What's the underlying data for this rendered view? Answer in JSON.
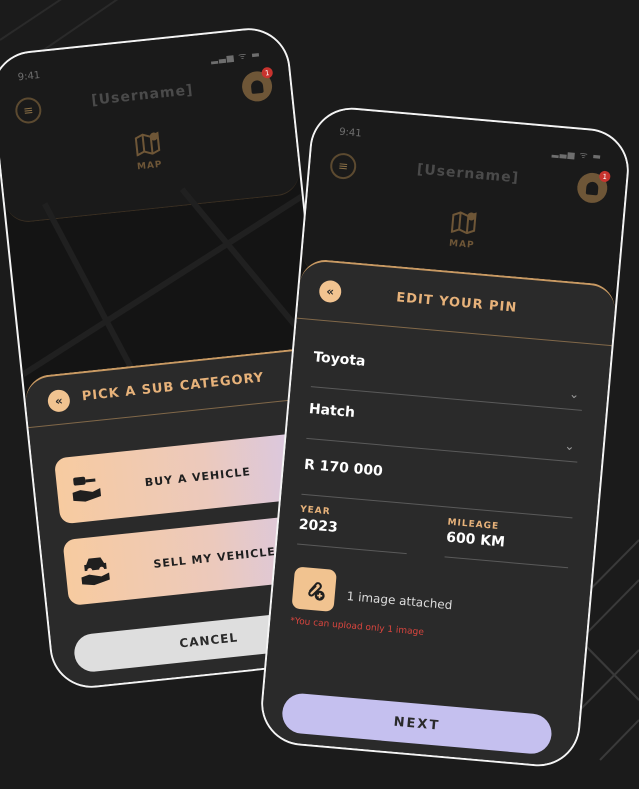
{
  "phone_a": {
    "status_time": "9:41",
    "status_icons": "▂▃▅ ᯤ ▬",
    "menu_icon": "menu-icon",
    "username": "[Username]",
    "notification_badge": "1",
    "map_label": "MAP",
    "sheet": {
      "title": "PICK A SUB CATEGORY",
      "back_glyph": "«",
      "options": [
        {
          "label": "BUY A VEHICLE",
          "icon": "hand-car-key-icon"
        },
        {
          "label": "SELL MY VEHICLE",
          "icon": "hand-car-icon"
        }
      ],
      "cancel_label": "CANCEL"
    }
  },
  "phone_b": {
    "status_time": "9:41",
    "status_icons": "▂▃▅ ᯤ ▬",
    "username": "[Username]",
    "notification_badge": "1",
    "map_label": "MAP",
    "sheet": {
      "title": "EDIT YOUR PIN",
      "back_glyph": "«",
      "make": "Toyota",
      "body_type": "Hatch",
      "price": "R 170 000",
      "year_label": "YEAR",
      "year_value": "2023",
      "mileage_label": "MILEAGE",
      "mileage_value": "600 KM",
      "attach_text": "1 image attached",
      "upload_note": "*You can upload only 1 image",
      "next_label": "NEXT"
    }
  },
  "colors": {
    "background": "#1b1b1b",
    "accent_gold": "#e7b27a",
    "sheet_bg": "#2a2a2a",
    "next_button": "#c5c0ef",
    "error_text": "#d8453e"
  }
}
